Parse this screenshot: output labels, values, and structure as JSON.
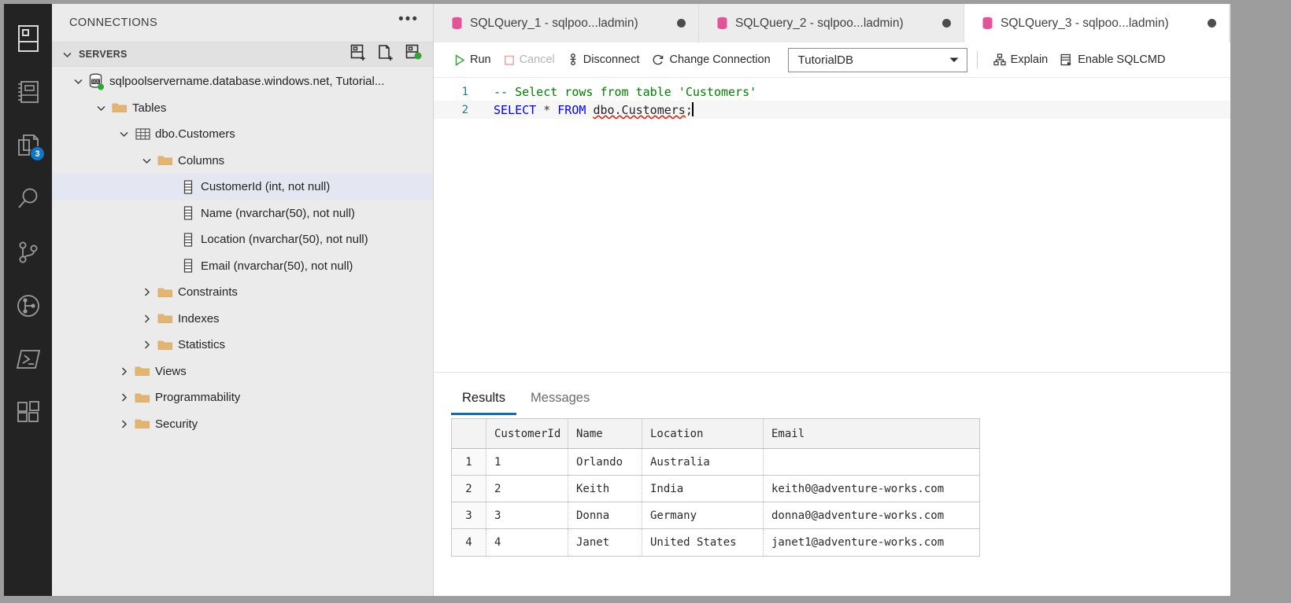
{
  "activitybar": {
    "items": [
      {
        "name": "servers-icon",
        "tooltip": "Servers"
      },
      {
        "name": "notebooks-icon",
        "tooltip": "Notebooks"
      },
      {
        "name": "source-files-icon",
        "tooltip": "Explorer",
        "badge": "3"
      },
      {
        "name": "search-icon",
        "tooltip": "Search"
      },
      {
        "name": "source-control-icon",
        "tooltip": "Source Control"
      },
      {
        "name": "git-graph-icon",
        "tooltip": "Git Graph"
      },
      {
        "name": "terminal-icon",
        "tooltip": "Terminal"
      },
      {
        "name": "extensions-icon",
        "tooltip": "Extensions"
      }
    ]
  },
  "sidebar": {
    "title": "CONNECTIONS",
    "more_label": "•••",
    "section": {
      "label": "SERVERS",
      "actions": [
        {
          "name": "new-connection-icon",
          "tooltip": "New Connection"
        },
        {
          "name": "new-server-group-icon",
          "tooltip": "New Server Group"
        },
        {
          "name": "active-connections-icon",
          "tooltip": "Show Active Connections"
        }
      ]
    },
    "tree": [
      {
        "label": "sqlpoolservername.database.windows.net, Tutorial...",
        "icon": "sql-server-icon",
        "indent": 0,
        "twisty": "down",
        "selected": false
      },
      {
        "label": "Tables",
        "icon": "folder-icon",
        "indent": 1,
        "twisty": "down",
        "selected": false
      },
      {
        "label": "dbo.Customers",
        "icon": "table-icon",
        "indent": 2,
        "twisty": "down",
        "selected": false
      },
      {
        "label": "Columns",
        "icon": "folder-icon",
        "indent": 3,
        "twisty": "down",
        "selected": false
      },
      {
        "label": "CustomerId (int, not null)",
        "icon": "column-icon",
        "indent": 4,
        "twisty": "none",
        "selected": true
      },
      {
        "label": "Name (nvarchar(50), not null)",
        "icon": "column-icon",
        "indent": 4,
        "twisty": "none",
        "selected": false
      },
      {
        "label": "Location (nvarchar(50), not null)",
        "icon": "column-icon",
        "indent": 4,
        "twisty": "none",
        "selected": false
      },
      {
        "label": "Email (nvarchar(50), not null)",
        "icon": "column-icon",
        "indent": 4,
        "twisty": "none",
        "selected": false
      },
      {
        "label": "Constraints",
        "icon": "folder-icon",
        "indent": 3,
        "twisty": "right",
        "selected": false
      },
      {
        "label": "Indexes",
        "icon": "folder-icon",
        "indent": 3,
        "twisty": "right",
        "selected": false
      },
      {
        "label": "Statistics",
        "icon": "folder-icon",
        "indent": 3,
        "twisty": "right",
        "selected": false
      },
      {
        "label": "Views",
        "icon": "folder-icon",
        "indent": 2,
        "twisty": "right",
        "selected": false
      },
      {
        "label": "Programmability",
        "icon": "folder-icon",
        "indent": 2,
        "twisty": "right",
        "selected": false
      },
      {
        "label": "Security",
        "icon": "folder-icon",
        "indent": 2,
        "twisty": "right",
        "selected": false
      }
    ]
  },
  "tabs": [
    {
      "label": "SQLQuery_1 - sqlpoo...ladmin)",
      "active": false,
      "dirty": true
    },
    {
      "label": "SQLQuery_2 - sqlpoo...ladmin)",
      "active": false,
      "dirty": true
    },
    {
      "label": "SQLQuery_3 - sqlpoo...ladmin)",
      "active": true,
      "dirty": true
    }
  ],
  "toolbar": {
    "run_label": "Run",
    "cancel_label": "Cancel",
    "disconnect_label": "Disconnect",
    "change_connection_label": "Change Connection",
    "database_value": "TutorialDB",
    "explain_label": "Explain",
    "enable_sqlcmd_label": "Enable SQLCMD"
  },
  "editor": {
    "lines": [
      {
        "number": "1",
        "comment": "-- Select rows from table 'Customers'"
      },
      {
        "number": "2",
        "kw1": "SELECT",
        "star": "*",
        "kw2": "FROM",
        "ident": "dbo.Customers",
        "semi": ";"
      }
    ]
  },
  "results": {
    "tabs": [
      {
        "label": "Results",
        "active": true
      },
      {
        "label": "Messages",
        "active": false
      }
    ],
    "columns": [
      "CustomerId",
      "Name",
      "Location",
      "Email"
    ],
    "rows": [
      {
        "n": "1",
        "CustomerId": "1",
        "Name": "Orlando",
        "Location": "Australia",
        "Email": ""
      },
      {
        "n": "2",
        "CustomerId": "2",
        "Name": "Keith",
        "Location": "India",
        "Email": "keith0@adventure-works.com"
      },
      {
        "n": "3",
        "CustomerId": "3",
        "Name": "Donna",
        "Location": "Germany",
        "Email": "donna0@adventure-works.com"
      },
      {
        "n": "4",
        "CustomerId": "4",
        "Name": "Janet",
        "Location": "United States",
        "Email": "janet1@adventure-works.com"
      }
    ]
  },
  "colors": {
    "accent": "#0f6cbd",
    "activitybar_bg": "#232323",
    "sidebar_bg": "#ebebeb",
    "db_icon": "#e2549a",
    "folder": "#e3b572",
    "status_green": "#31a531",
    "comment_green": "#008000",
    "keyword_blue": "#0000ff",
    "badge_blue": "#0f76c8"
  }
}
